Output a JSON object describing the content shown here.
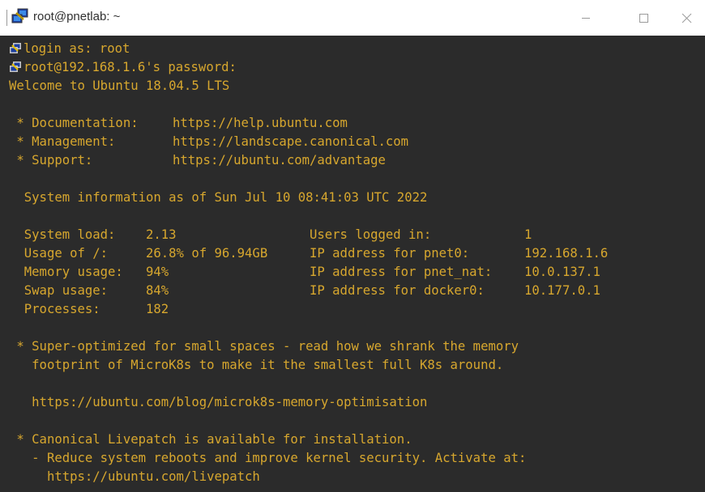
{
  "window": {
    "title": "root@pnetlab: ~",
    "controls": {
      "minimize": "minimize-icon",
      "maximize": "maximize-icon",
      "close": "close-icon"
    },
    "app_icon": "putty-icon"
  },
  "colors": {
    "terminal_background": "#2b2b2b",
    "terminal_text": "#d7a72e",
    "title_text": "#303030"
  },
  "terminal": {
    "login_prompt": "login as: root",
    "password_prompt": "root@192.168.1.6's password:",
    "welcome": "Welcome to Ubuntu 18.04.5 LTS",
    "links": [
      {
        "label": " * Documentation:",
        "url": "https://help.ubuntu.com"
      },
      {
        "label": " * Management:",
        "url": "https://landscape.canonical.com"
      },
      {
        "label": " * Support:",
        "url": "https://ubuntu.com/advantage"
      }
    ],
    "sysinfo_header": "  System information as of Sun Jul 10 08:41:03 UTC 2022",
    "sysinfo": [
      {
        "k1": "  System load:",
        "v1": "2.13",
        "k2": "Users logged in:",
        "v2": "1"
      },
      {
        "k1": "  Usage of /:",
        "v1": "26.8% of 96.94GB",
        "k2": "IP address for pnet0:",
        "v2": "192.168.1.6"
      },
      {
        "k1": "  Memory usage:",
        "v1": "94%",
        "k2": "IP address for pnet_nat:",
        "v2": "10.0.137.1"
      },
      {
        "k1": "  Swap usage:",
        "v1": "84%",
        "k2": "IP address for docker0:",
        "v2": "10.177.0.1"
      },
      {
        "k1": "  Processes:",
        "v1": "182",
        "k2": "",
        "v2": ""
      }
    ],
    "microk8s": [
      " * Super-optimized for small spaces - read how we shrank the memory",
      "   footprint of MicroK8s to make it the smallest full K8s around."
    ],
    "microk8s_url": "   https://ubuntu.com/blog/microk8s-memory-optimisation",
    "livepatch": [
      " * Canonical Livepatch is available for installation.",
      "   - Reduce system reboots and improve kernel security. Activate at:",
      "     https://ubuntu.com/livepatch"
    ]
  }
}
